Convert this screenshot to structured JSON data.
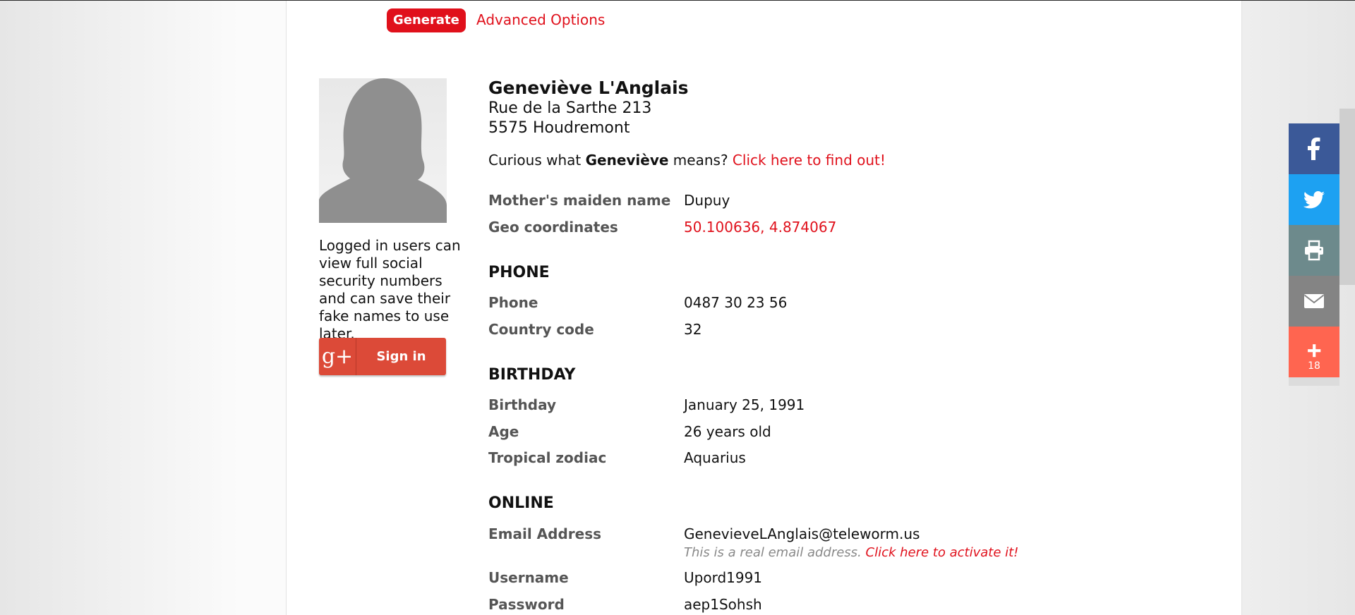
{
  "toolbar": {
    "generate_label": "Generate",
    "advanced_label": "Advanced Options"
  },
  "sidebar": {
    "login_note": "Logged in users can view full social security numbers and can save their fake names to use later.",
    "signin_label": "Sign in",
    "gplus_glyph": "g+"
  },
  "identity": {
    "full_name": "Geneviève L'Anglais",
    "street": "Rue de la Sarthe 213",
    "city": "5575 Houdremont",
    "curious_prefix": "Curious what ",
    "first_name": "Geneviève",
    "curious_suffix": " means? ",
    "curious_link": "Click here to find out!"
  },
  "details": {
    "maiden_label": "Mother's maiden name",
    "maiden_value": "Dupuy",
    "geo_label": "Geo coordinates",
    "geo_value": "50.100636, 4.874067"
  },
  "phone": {
    "heading": "PHONE",
    "phone_label": "Phone",
    "phone_value": "0487 30 23 56",
    "cc_label": "Country code",
    "cc_value": "32"
  },
  "birthday": {
    "heading": "BIRTHDAY",
    "birthday_label": "Birthday",
    "birthday_value": "January 25, 1991",
    "age_label": "Age",
    "age_value": "26 years old",
    "zodiac_label": "Tropical zodiac",
    "zodiac_value": "Aquarius"
  },
  "online": {
    "heading": "ONLINE",
    "email_label": "Email Address",
    "email_value": "GenevieveLAnglais@teleworm.us",
    "email_note": "This is a real email address. ",
    "email_activate": "Click here to activate it!",
    "username_label": "Username",
    "username_value": "Upord1991",
    "password_label": "Password",
    "password_value": "aep1Sohsh"
  },
  "share_bar": {
    "count": "18",
    "icons": [
      "facebook-icon",
      "twitter-icon",
      "print-icon",
      "mail-icon",
      "plus-icon"
    ],
    "colors": {
      "facebook": "#3b5998",
      "twitter": "#1da1f2",
      "print": "#6d8a8c",
      "mail": "#848484",
      "more": "#ff6550"
    }
  },
  "colors": {
    "accent": "#e0101b",
    "label": "#555555",
    "google": "#dc4a38"
  }
}
